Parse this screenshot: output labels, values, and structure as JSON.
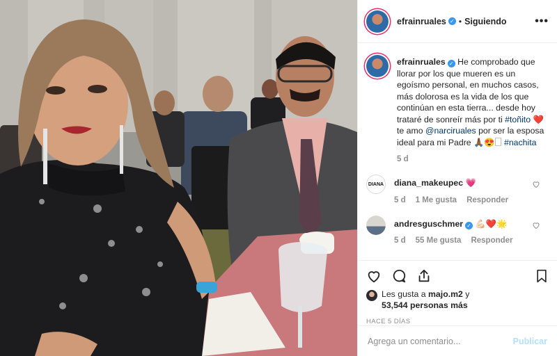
{
  "post": {
    "username": "efrainruales",
    "follow_status": "Siguiendo",
    "more_label": "•••",
    "caption_parts": {
      "text_1": "He comprobado que llorar por los que mueren es un egoísmo personal, en muchos casos, más dolorosa es la vida de los que continúan en esta tierra... desde hoy trataré de sonreír más por ti ",
      "hashtag_1": "#toñito",
      "text_2": " ❤️ te amo ",
      "mention_1": "@narciruales",
      "text_3": " por ser la esposa ideal para mi Padre 🙏🏾😍🗌 ",
      "hashtag_2": "#nachita"
    },
    "caption_time": "5 d"
  },
  "comments": [
    {
      "username": "diana_makeupec",
      "text": "💗",
      "time": "5 d",
      "likes": "1 Me gusta",
      "reply_label": "Responder",
      "avatar_text": "DIANA"
    },
    {
      "username": "andresguschmer",
      "text": "💪🏻❤️🌟",
      "time": "5 d",
      "likes": "55 Me gusta",
      "reply_label": "Responder"
    }
  ],
  "likes": {
    "prefix": "Les gusta a ",
    "user": "majo.m2",
    "middle": " y",
    "count": "53,544 personas más"
  },
  "posted_ago": "HACE 5 DÍAS",
  "add_comment": {
    "placeholder": "Agrega un comentario...",
    "post_label": "Publicar"
  },
  "icons": [
    "heart-icon",
    "comment-icon",
    "share-icon",
    "bookmark-icon",
    "verified-icon",
    "more-icon"
  ],
  "colors": {
    "link": "#00376b",
    "verified": "#3897f0",
    "secondary_text": "#8e8e8e",
    "disabled_post": "#b2dffc"
  }
}
